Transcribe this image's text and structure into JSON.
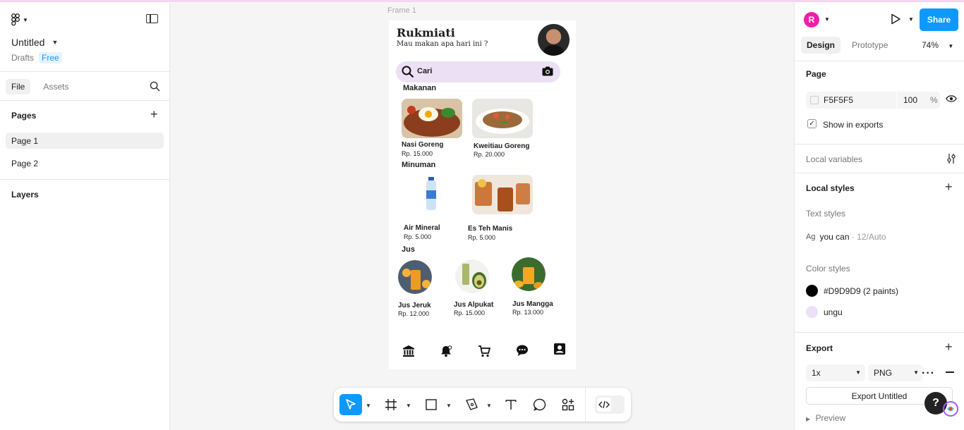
{
  "file": {
    "title": "Untitled",
    "location": "Drafts",
    "plan": "Free"
  },
  "left_tabs": [
    "File",
    "Assets"
  ],
  "pages": {
    "heading": "Pages",
    "items": [
      "Page 1",
      "Page 2"
    ]
  },
  "layers": {
    "heading": "Layers"
  },
  "canvas": {
    "frame_label": "Frame 1",
    "app": {
      "greeting_name": "Rukmiati",
      "greeting_sub": "Mau makan apa hari ini ?",
      "search_label": "Cari",
      "categories": [
        "Makanan",
        "Minuman",
        "Jus"
      ],
      "makanan": [
        {
          "name": "Nasi Goreng",
          "price": "Rp. 15.000"
        },
        {
          "name": "Kweitiau Goreng",
          "price": "Rp. 20.000"
        }
      ],
      "minuman": [
        {
          "name": "Air Mineral",
          "price": "Rp. 5.000"
        },
        {
          "name": "Es Teh Manis",
          "price": "Rp. 5.000"
        }
      ],
      "jus": [
        {
          "name": "Jus Jeruk",
          "price": "Rp. 12.000"
        },
        {
          "name": "Jus Alpukat",
          "price": "Rp. 15.000"
        },
        {
          "name": "Jus Mangga",
          "price": "Rp. 13.000"
        }
      ],
      "nav_icons": [
        "bank-icon",
        "notification-icon",
        "cart-icon",
        "chat-icon",
        "profile-icon"
      ]
    }
  },
  "toolbar": {
    "tools": [
      "move-tool",
      "frame-tool",
      "rectangle-tool",
      "pen-tool",
      "text-tool",
      "comment-tool",
      "actions-tool",
      "dev-mode-toggle"
    ]
  },
  "right": {
    "user_initial": "R",
    "share_label": "Share",
    "tabs": [
      "Design",
      "Prototype"
    ],
    "zoom": "74%",
    "page": {
      "heading": "Page",
      "color_hex": "F5F5F5",
      "opacity": "100",
      "opacity_unit": "%",
      "show_in_exports": "Show in exports"
    },
    "local_variables": "Local variables",
    "local_styles": {
      "heading": "Local styles",
      "text_styles_label": "Text styles",
      "text_style_prefix": "Ag",
      "text_style_name": "you can",
      "text_style_meta": "· 12/Auto",
      "color_styles_label": "Color styles",
      "color_styles": [
        {
          "name": "#D9D9D9 (2 paints)",
          "color": "#000000"
        },
        {
          "name": "ungu",
          "color": "#ece0f5"
        }
      ]
    },
    "export": {
      "heading": "Export",
      "scale": "1x",
      "format": "PNG",
      "button": "Export Untitled",
      "preview": "Preview"
    }
  },
  "colors": {
    "accent": "#0d99ff",
    "avatar": "#f21da8",
    "search_bg": "#ece0f5"
  }
}
